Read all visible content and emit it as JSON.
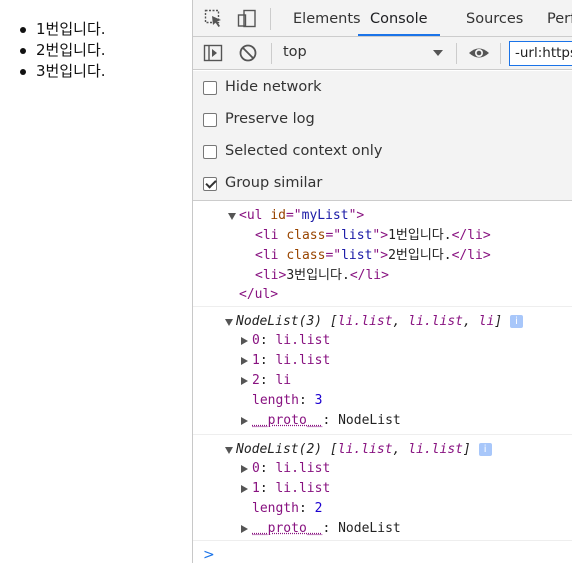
{
  "page": {
    "items": [
      "1번입니다.",
      "2번입니다.",
      "3번입니다."
    ]
  },
  "devtools": {
    "tabs": [
      "Elements",
      "Console",
      "Sources",
      "Perf"
    ],
    "active_tab": "Console",
    "context": "top",
    "filter_value": "-url:https"
  },
  "settings": {
    "hide_network": "Hide network",
    "preserve_log": "Preserve log",
    "selected_context_only": "Selected context only",
    "group_similar": "Group similar"
  },
  "console": {
    "ul_id": "myList",
    "li_class": "list",
    "li1_text": "1번입니다.",
    "li2_text": "2번입니다.",
    "li3_text": "3번입니다.",
    "nodelist1_title": "NodeList(3)",
    "nodelist1_items": [
      "li.list",
      "li.list",
      "li"
    ],
    "nodelist1_entries": [
      {
        "k": "0",
        "v": "li.list"
      },
      {
        "k": "1",
        "v": "li.list"
      },
      {
        "k": "2",
        "v": "li"
      }
    ],
    "nodelist1_length": "3",
    "nodelist2_title": "NodeList(2)",
    "nodelist2_items": [
      "li.list",
      "li.list"
    ],
    "nodelist2_entries": [
      {
        "k": "0",
        "v": "li.list"
      },
      {
        "k": "1",
        "v": "li.list"
      }
    ],
    "nodelist2_length": "2",
    "proto_label": "__proto__",
    "proto_value": "NodeList",
    "length_label": "length",
    "prompt": ">"
  },
  "colors": {
    "accent": "#1a73e8",
    "tag": "#881280",
    "attr": "#994500",
    "attr_value": "#1a1aa6"
  }
}
